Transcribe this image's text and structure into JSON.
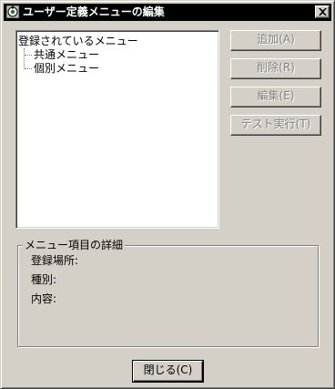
{
  "window": {
    "title": "ユーザー定義メニューの編集"
  },
  "tree": {
    "root": "登録されているメニュー",
    "children": [
      "共通メニュー",
      "個別メニュー"
    ]
  },
  "buttons": {
    "add": "追加(A)",
    "delete": "削除(R)",
    "edit": "編集(E)",
    "test_run": "テスト実行(T)",
    "close": "閉じる(C)"
  },
  "details": {
    "group_title": "メニュー項目の詳細",
    "location_label": "登録場所:",
    "type_label": "種別:",
    "content_label": "内容:"
  },
  "icons": {
    "app": "app-icon",
    "close": "close-icon"
  }
}
